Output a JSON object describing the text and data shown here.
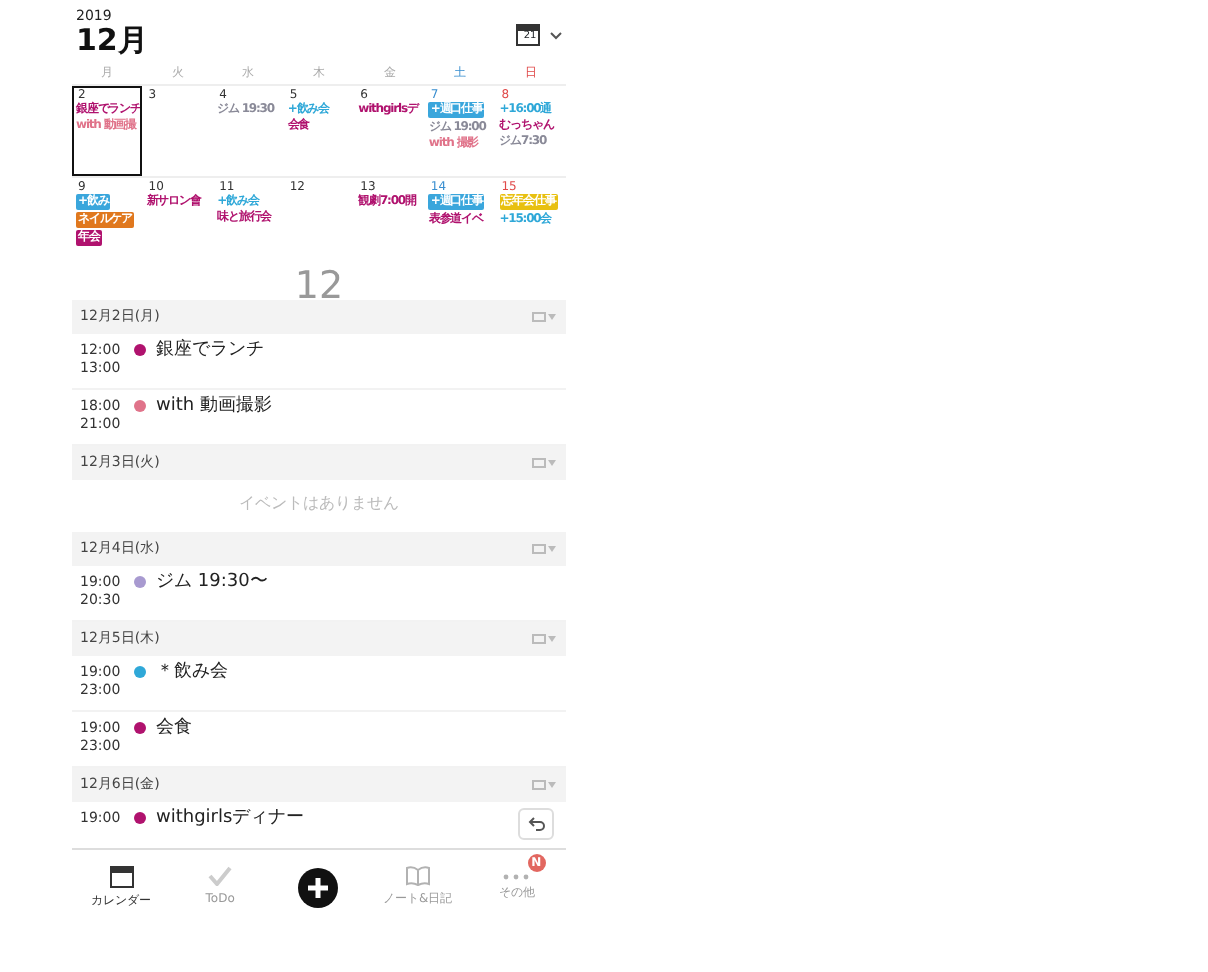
{
  "header": {
    "year": "2019",
    "month": "12月",
    "today_icon": "21"
  },
  "weekdays": [
    {
      "label": "月",
      "kind": "weekday"
    },
    {
      "label": "火",
      "kind": "weekday"
    },
    {
      "label": "水",
      "kind": "weekday"
    },
    {
      "label": "木",
      "kind": "weekday"
    },
    {
      "label": "金",
      "kind": "weekday"
    },
    {
      "label": "土",
      "kind": "saturday"
    },
    {
      "label": "日",
      "kind": "sunday"
    }
  ],
  "weeks": [
    [
      {
        "day": "2",
        "selected": true,
        "events": [
          {
            "title": "銀座でランチ",
            "kind": "text",
            "color": "#b0126e"
          },
          {
            "title": "with 動画撮",
            "kind": "text",
            "color": "#e0738a"
          }
        ]
      },
      {
        "day": "3",
        "selected": false
      },
      {
        "day": "4",
        "selected": false,
        "events": [
          {
            "title": "ジム 19:30",
            "kind": "text",
            "color": "#8a8a98"
          }
        ]
      },
      {
        "day": "5",
        "selected": false,
        "events": [
          {
            "title": "+飲み会",
            "kind": "text",
            "color": "#2fa8d8"
          },
          {
            "title": "会食",
            "kind": "text",
            "color": "#b0126e"
          }
        ]
      },
      {
        "day": "6",
        "selected": false,
        "events": [
          {
            "title": "withgirlsデ",
            "kind": "text",
            "color": "#b0126e"
          }
        ]
      },
      {
        "day": "7",
        "selected": false,
        "events": [
          {
            "title": "+週口仕事",
            "kind": "chip",
            "color": "#3aa6dc"
          },
          {
            "title": "ジム 19:00",
            "kind": "text",
            "color": "#8a8a98"
          },
          {
            "title": "with 撮影",
            "kind": "text",
            "color": "#e0738a"
          }
        ]
      },
      {
        "day": "8",
        "selected": false,
        "events": [
          {
            "title": "+16:00通",
            "kind": "text",
            "color": "#2fa8d8"
          },
          {
            "title": "むっちゃん",
            "kind": "text",
            "color": "#b0126e"
          },
          {
            "title": "ジム7:30",
            "kind": "text",
            "color": "#8a8a98"
          }
        ]
      }
    ],
    [
      {
        "day": "9",
        "selected": false,
        "events": [
          {
            "title": "+飲み",
            "kind": "chip",
            "color": "#3aa6dc"
          },
          {
            "title": "ネイルケア",
            "kind": "chip",
            "color": "#e0781e"
          },
          {
            "title": "年会",
            "kind": "chip",
            "color": "#b0126e"
          }
        ]
      },
      {
        "day": "10",
        "selected": false,
        "events": [
          {
            "title": "新サロン會",
            "kind": "text",
            "color": "#b0126e"
          }
        ]
      },
      {
        "day": "11",
        "selected": false,
        "events": [
          {
            "title": "+飲み会",
            "kind": "text",
            "color": "#2fa8d8"
          },
          {
            "title": "味と旅行会",
            "kind": "text",
            "color": "#b0126e"
          }
        ]
      },
      {
        "day": "12",
        "selected": false
      },
      {
        "day": "13",
        "selected": false,
        "events": [
          {
            "title": "観劇7:00開",
            "kind": "text",
            "color": "#b0126e"
          }
        ]
      },
      {
        "day": "14",
        "selected": false,
        "events": [
          {
            "title": "+週口仕事",
            "kind": "chip",
            "color": "#3aa6dc"
          },
          {
            "title": "表参道イベ",
            "kind": "text",
            "color": "#b0126e"
          }
        ]
      },
      {
        "day": "15",
        "selected": false,
        "events": [
          {
            "title": "忘年会仕事",
            "kind": "chip",
            "color": "#e8c010"
          },
          {
            "title": "+15:00会",
            "kind": "text",
            "color": "#2fa8d8"
          }
        ]
      }
    ]
  ],
  "month_overlay": "12",
  "agenda": [
    {
      "date": "12月2日(月)",
      "events": [
        {
          "start": "12:00",
          "end": "13:00",
          "title": "銀座でランチ",
          "color": "#b0126e"
        },
        {
          "start": "18:00",
          "end": "21:00",
          "title": "with 動画撮影",
          "color": "#e0738a"
        }
      ]
    },
    {
      "date": "12月3日(火)",
      "empty_text": "イベントはありません"
    },
    {
      "date": "12月4日(水)",
      "events": [
        {
          "start": "19:00",
          "end": "20:30",
          "title": "ジム 19:30〜",
          "color": "#a89ad0"
        }
      ]
    },
    {
      "date": "12月5日(木)",
      "events": [
        {
          "start": "19:00",
          "end": "23:00",
          "title": "＊飲み会",
          "color": "#2fa8d8"
        },
        {
          "start": "19:00",
          "end": "23:00",
          "title": "会食",
          "color": "#b0126e"
        }
      ]
    },
    {
      "date": "12月6日(金)",
      "events": [
        {
          "start": "19:00",
          "title": "withgirlsディナー",
          "color": "#b0126e"
        }
      ]
    }
  ],
  "tabs": [
    {
      "label": "カレンダー",
      "kind": "calendar",
      "selected": true
    },
    {
      "label": "ToDo",
      "kind": "todo",
      "selected": false
    },
    {
      "kind": "add"
    },
    {
      "label": "ノート&日記",
      "kind": "note",
      "selected": false
    },
    {
      "label": "その他",
      "kind": "more",
      "selected": false,
      "badge": "N"
    }
  ]
}
